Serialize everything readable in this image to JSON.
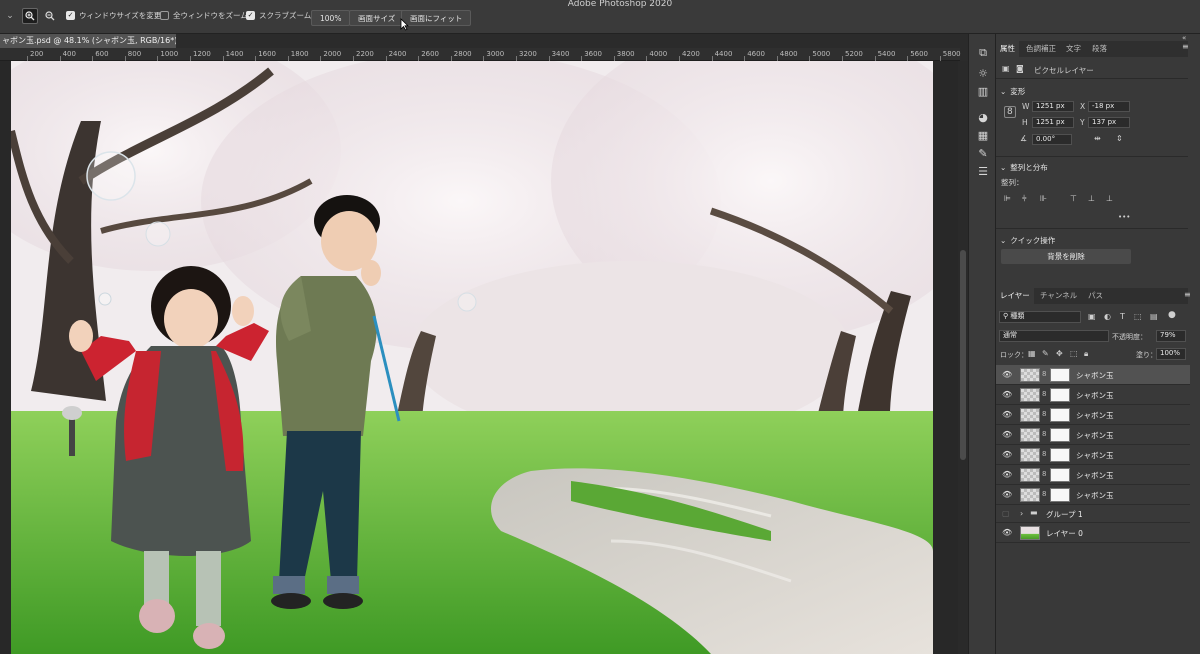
{
  "app": {
    "title": "Adobe Photoshop 2020"
  },
  "options": {
    "zoom_in_icon": "zoom-in-icon",
    "zoom_out_icon": "zoom-out-icon",
    "resize_windows": {
      "label": "ウィンドウサイズを変更",
      "checked": true
    },
    "zoom_all_windows": {
      "label": "全ウィンドウをズーム",
      "checked": false
    },
    "scrubby_zoom": {
      "label": "スクラブズーム",
      "checked": true
    },
    "btn_100": "100%",
    "btn_fill_screen": "画面サイズ",
    "btn_fit_screen": "画面にフィット"
  },
  "document": {
    "tab_title": "ャボン玉.psd @ 48.1% (シャボン玉, RGB/16*)",
    "ruler_labels": [
      "200",
      "400",
      "600",
      "800",
      "1000",
      "1200",
      "1400",
      "1600",
      "1800",
      "2000",
      "2200",
      "2400",
      "2600",
      "2800",
      "3000",
      "3200",
      "3400",
      "3600",
      "3800",
      "4000",
      "4200",
      "4400",
      "4600",
      "4800",
      "5000",
      "5200",
      "5400",
      "5600",
      "5800"
    ]
  },
  "properties": {
    "tabs": [
      "属性",
      "色調補正",
      "文字",
      "段落"
    ],
    "layer_kind": "ピクセルレイヤー",
    "transform": {
      "title": "変形",
      "w_label": "W",
      "w": "1251 px",
      "x_label": "X",
      "x": "-18 px",
      "h_label": "H",
      "h": "1251 px",
      "y_label": "Y",
      "y": "137 px",
      "angle": "0.00°"
    },
    "align": {
      "title": "整列と分布",
      "sub": "整列：",
      "more": "•••"
    },
    "quick_actions": {
      "title": "クイック操作",
      "remove_bg": "背景を削除"
    }
  },
  "layers": {
    "tabs": [
      "レイヤー",
      "チャンネル",
      "パス"
    ],
    "filter_kind": "種類",
    "blend_mode": "通常",
    "opacity_label": "不透明度：",
    "opacity": "79%",
    "lock_label": "ロック：",
    "fill_label": "塗り：",
    "fill": "100%",
    "items": [
      {
        "name": "シャボン玉",
        "selected": true
      },
      {
        "name": "シャボン玉",
        "selected": false
      },
      {
        "name": "シャボン玉",
        "selected": false
      },
      {
        "name": "シャボン玉",
        "selected": false
      },
      {
        "name": "シャボン玉",
        "selected": false
      },
      {
        "name": "シャボン玉",
        "selected": false
      },
      {
        "name": "シャボン玉",
        "selected": false
      }
    ],
    "group": "グループ 1",
    "base_layer": "レイヤー 0"
  }
}
